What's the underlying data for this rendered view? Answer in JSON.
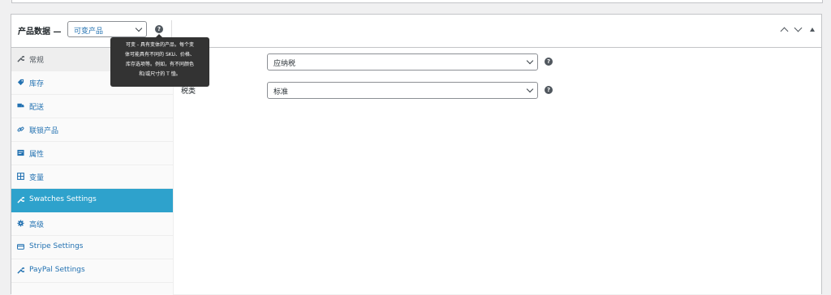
{
  "header": {
    "title": "产品数据 —",
    "product_type": "可变产品",
    "help_glyph": "?"
  },
  "tooltip": {
    "lines": [
      "可变 - 具有变体的产品，每个变",
      "体可能具有不同的 SKU、价格、",
      "库存选项等。例如，有不同颜色",
      "和/或尺寸的 T 恤。"
    ]
  },
  "tabs": [
    {
      "label": "常规",
      "icon": "wrench-icon"
    },
    {
      "label": "库存",
      "icon": "tag-icon"
    },
    {
      "label": "配送",
      "icon": "truck-icon"
    },
    {
      "label": "联锁产品",
      "icon": "link-icon"
    },
    {
      "label": "属性",
      "icon": "list-icon"
    },
    {
      "label": "变量",
      "icon": "grid-icon"
    },
    {
      "label": "Swatches Settings",
      "icon": "wrench-icon"
    },
    {
      "label": "高级",
      "icon": "gear-icon"
    },
    {
      "label": "Stripe Settings",
      "icon": "card-icon"
    },
    {
      "label": "PayPal Settings",
      "icon": "wrench-icon"
    }
  ],
  "active_tab": "Swatches Settings",
  "fields": {
    "tax_status_value": "应纳税",
    "tax_class_label": "税类",
    "tax_class_value": "标准"
  },
  "colors": {
    "accent": "#2ea2cc",
    "link": "#2271b1",
    "tooltip_bg": "#333333"
  }
}
